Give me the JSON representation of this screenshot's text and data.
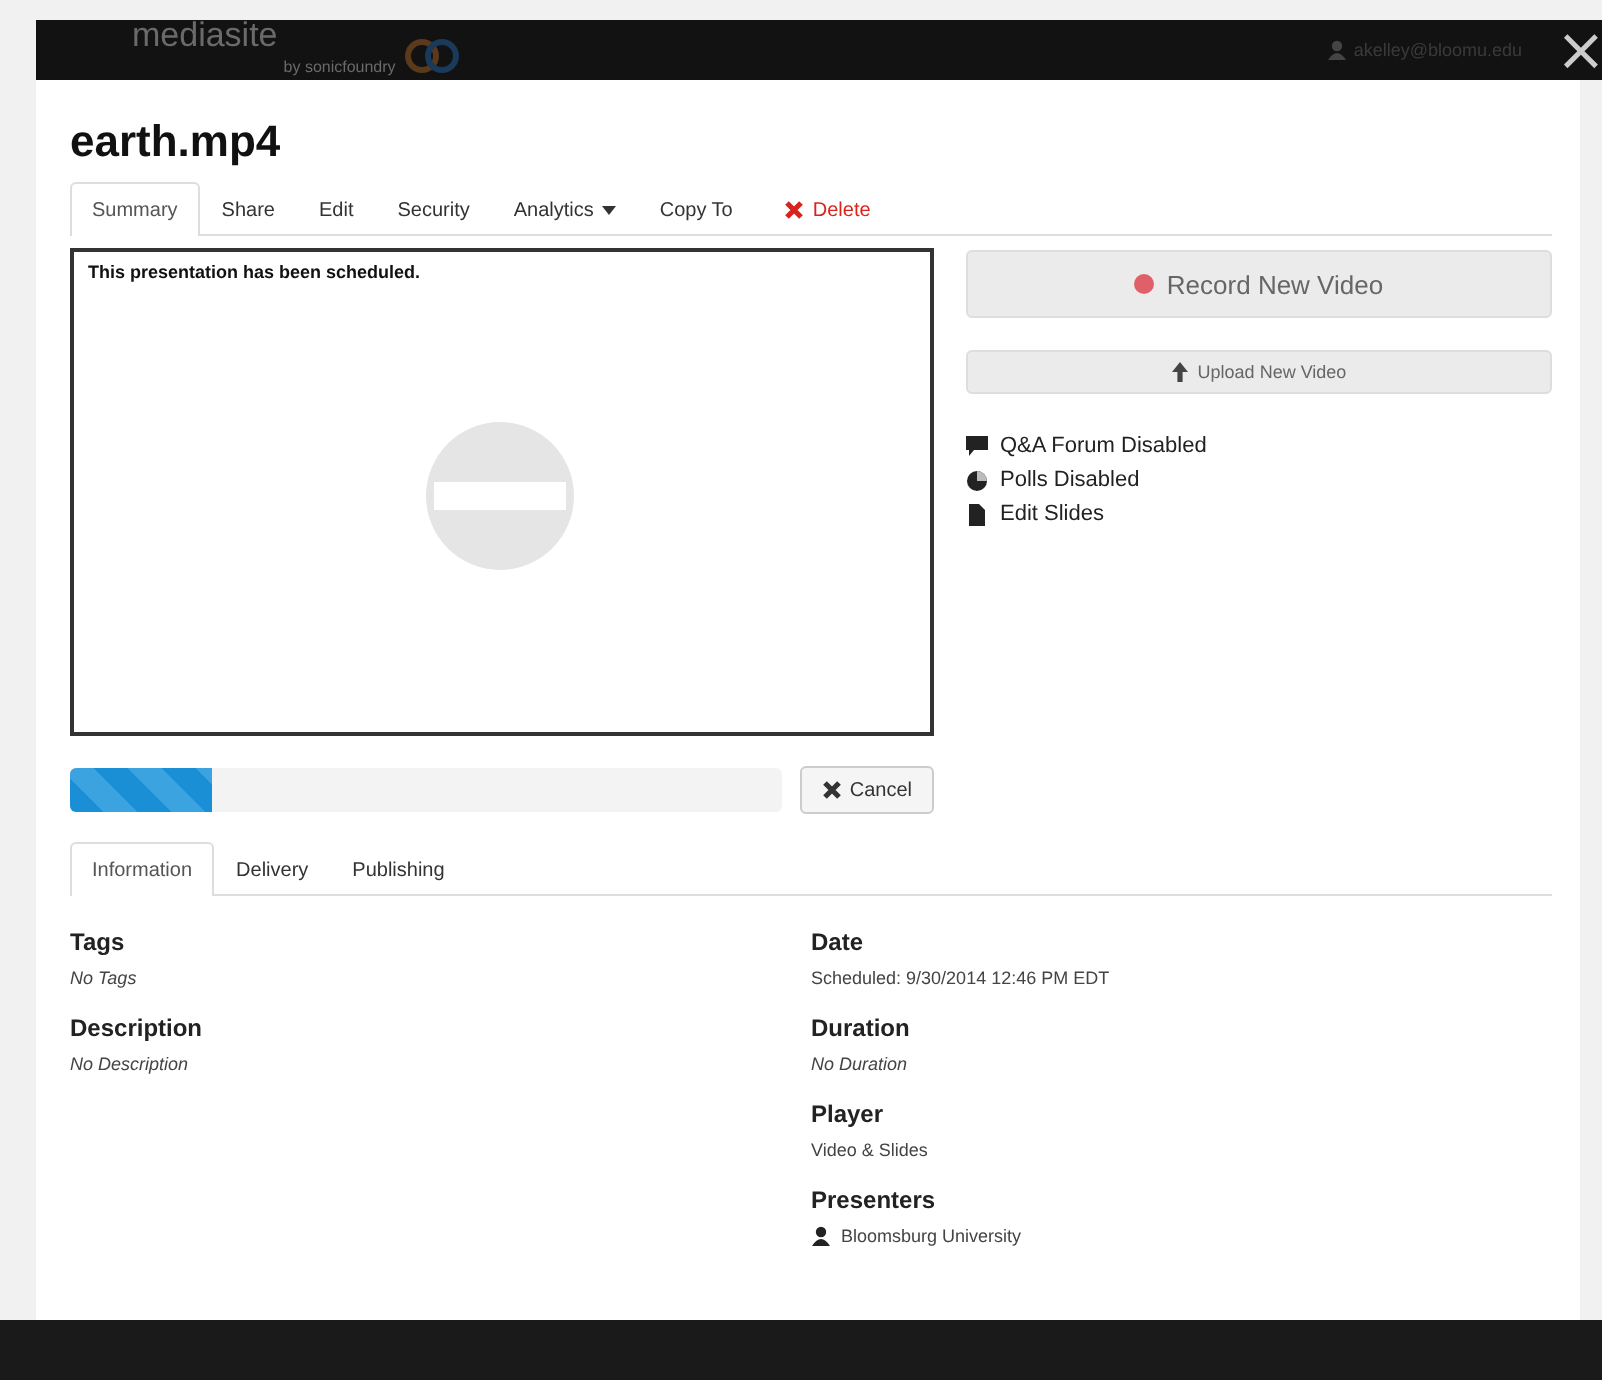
{
  "header": {
    "logo": "mediasite",
    "logo_sub": "by sonicfoundry",
    "user": "akelley@bloomu.edu",
    "close": "×"
  },
  "title": "earth.mp4",
  "tabs": [
    {
      "label": "Summary",
      "selected": true,
      "kind": "plain"
    },
    {
      "label": "Share",
      "selected": false,
      "kind": "plain"
    },
    {
      "label": "Edit",
      "selected": false,
      "kind": "plain"
    },
    {
      "label": "Security",
      "selected": false,
      "kind": "plain"
    },
    {
      "label": "Analytics",
      "selected": false,
      "kind": "dropdown"
    },
    {
      "label": "Copy To",
      "selected": false,
      "kind": "plain"
    },
    {
      "label": "Delete",
      "selected": false,
      "kind": "delete"
    }
  ],
  "player": {
    "message": "This presentation has been scheduled."
  },
  "record_button": "Record New Video",
  "upload_button": "Upload New Video",
  "features": [
    {
      "label": "Q&A Forum Disabled",
      "kind": "forum"
    },
    {
      "label": "Polls Disabled",
      "kind": "polls"
    },
    {
      "label": "Edit Slides",
      "kind": "slides"
    }
  ],
  "progress": {
    "level": 0.2
  },
  "cancel_button": "Cancel",
  "info_tabs": [
    {
      "label": "Information",
      "selected": true
    },
    {
      "label": "Delivery",
      "selected": false
    },
    {
      "label": "Publishing",
      "selected": false
    }
  ],
  "left_fields": [
    {
      "heading": "Tags",
      "value": "No Tags",
      "empty": true
    },
    {
      "heading": "Description",
      "value": "No Description",
      "empty": true
    }
  ],
  "right_fields": [
    {
      "heading": "Date",
      "value": "Scheduled: 9/30/2014 12:46 PM EDT",
      "empty": false
    },
    {
      "heading": "Duration",
      "value": "No Duration",
      "empty": true
    },
    {
      "heading": "Player",
      "value": "Video & Slides",
      "empty": false
    },
    {
      "heading": "Presenters",
      "value": "Bloomsburg University",
      "empty": false,
      "kind": "person"
    }
  ]
}
